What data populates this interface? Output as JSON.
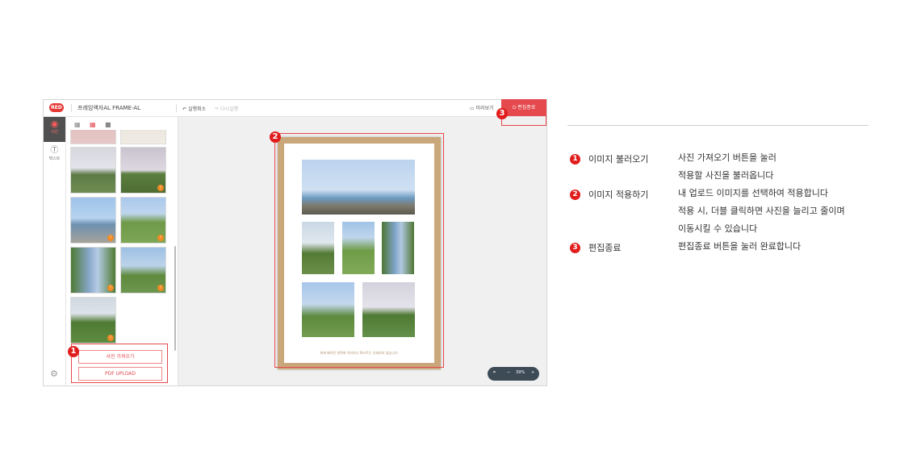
{
  "editor": {
    "logo": "RED",
    "product_title": "프레임액자AL FRAME-AL",
    "undo_label": "실행취소",
    "redo_label": "다시실행",
    "preview_label": "미리보기",
    "finish_label": "편집종료",
    "rail": {
      "photo_label": "사진",
      "text_label": "텍스트"
    },
    "panel": {
      "view_options": [
        "list",
        "grid",
        "large"
      ],
      "selected_view": "grid",
      "thumbnails": [
        {
          "badge": ""
        },
        {
          "badge": ""
        },
        {
          "badge": ""
        },
        {
          "badge": "!"
        },
        {
          "badge": "!"
        },
        {
          "badge": "!"
        },
        {
          "badge": "!"
        },
        {
          "badge": "!"
        },
        {
          "badge": "!"
        }
      ],
      "import_button": "사진 가져오기",
      "pdf_button": "PDF UPLOAD"
    },
    "canvas": {
      "caption": "위에 배치된 영역에 이미지나 텍스트는 인쇄되지 않습니다.",
      "zoom_value": "39%",
      "zoom_minus": "−",
      "zoom_plus": "+"
    },
    "callouts": [
      "1",
      "2",
      "3"
    ]
  },
  "legend": [
    {
      "number": "1",
      "term": "이미지 불러오기",
      "lines": [
        "사진 가져오기 버튼을 눌러",
        "적용할 사진을 불러옵니다"
      ]
    },
    {
      "number": "2",
      "term": "이미지 적용하기",
      "lines": [
        "내 업로드 이미지를 선택하여 적용합니다",
        "적용 시, 더블 클릭하면 사진을 늘리고 줄이며",
        "이동시킬 수 있습니다"
      ]
    },
    {
      "number": "3",
      "term": "편집종료",
      "lines": [
        "편집종료 버튼을 눌러 완료합니다"
      ]
    }
  ],
  "colors": {
    "accent": "#e5484d",
    "callout": "#e11d1d",
    "frame": "#c9a77a"
  }
}
